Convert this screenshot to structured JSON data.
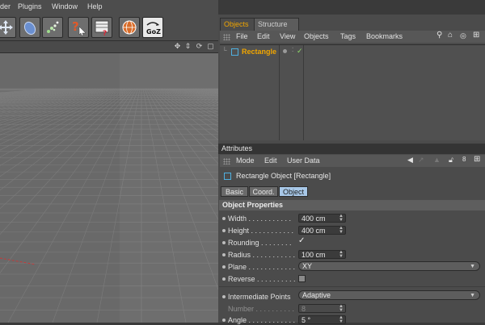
{
  "menubar": {
    "items": [
      "der",
      "Plugins",
      "Window",
      "Help"
    ]
  },
  "toolbar": {
    "buttons": [
      "move-arrows-icon",
      "deformer-icon",
      "particle-icon",
      "help-pointer-icon",
      "render-settings-icon",
      "globe-icon",
      "goz-icon"
    ],
    "goz_label": "GoZ"
  },
  "viewport_header": {
    "icons": [
      "move-view-icon",
      "zoom-view-icon",
      "rotate-view-icon",
      "maximize-view-icon"
    ]
  },
  "object_manager": {
    "tabs": [
      "Objects",
      "Structure"
    ],
    "menu": [
      "File",
      "Edit",
      "View",
      "Objects",
      "Tags",
      "Bookmarks"
    ],
    "objects": [
      {
        "name": "Rectangle",
        "checked": "✓"
      }
    ]
  },
  "attributes": {
    "title": "Attributes",
    "menu": [
      "Mode",
      "Edit",
      "User Data"
    ],
    "object_title": "Rectangle Object [Rectangle]",
    "tabs": [
      "Basic",
      "Coord.",
      "Object"
    ],
    "section": "Object Properties",
    "rows": {
      "width": {
        "label": "Width . . . . . . . . . . .",
        "value": "400 cm"
      },
      "height": {
        "label": "Height . . . . . . . . . . .",
        "value": "400 cm"
      },
      "rounding": {
        "label": "Rounding . . . . . . . .",
        "value": "✓"
      },
      "radius": {
        "label": "Radius . . . . . . . . . . .",
        "value": "100 cm"
      },
      "plane": {
        "label": "Plane . . . . . . . . . . . .",
        "value": "XY"
      },
      "reverse": {
        "label": "Reverse . . . . . . . . . ."
      },
      "intermediate": {
        "label": "Intermediate Points",
        "value": "Adaptive"
      },
      "number": {
        "label": "Number . . . . . . . . . .",
        "value": "8"
      },
      "angle": {
        "label": "Angle . . . . . . . . . . . .",
        "value": "5 °"
      }
    }
  },
  "colors": {
    "accent": "#f0a500",
    "active_tab": "#a8c8e8",
    "panel": "#4b4b4b",
    "viewport": "#696969"
  }
}
